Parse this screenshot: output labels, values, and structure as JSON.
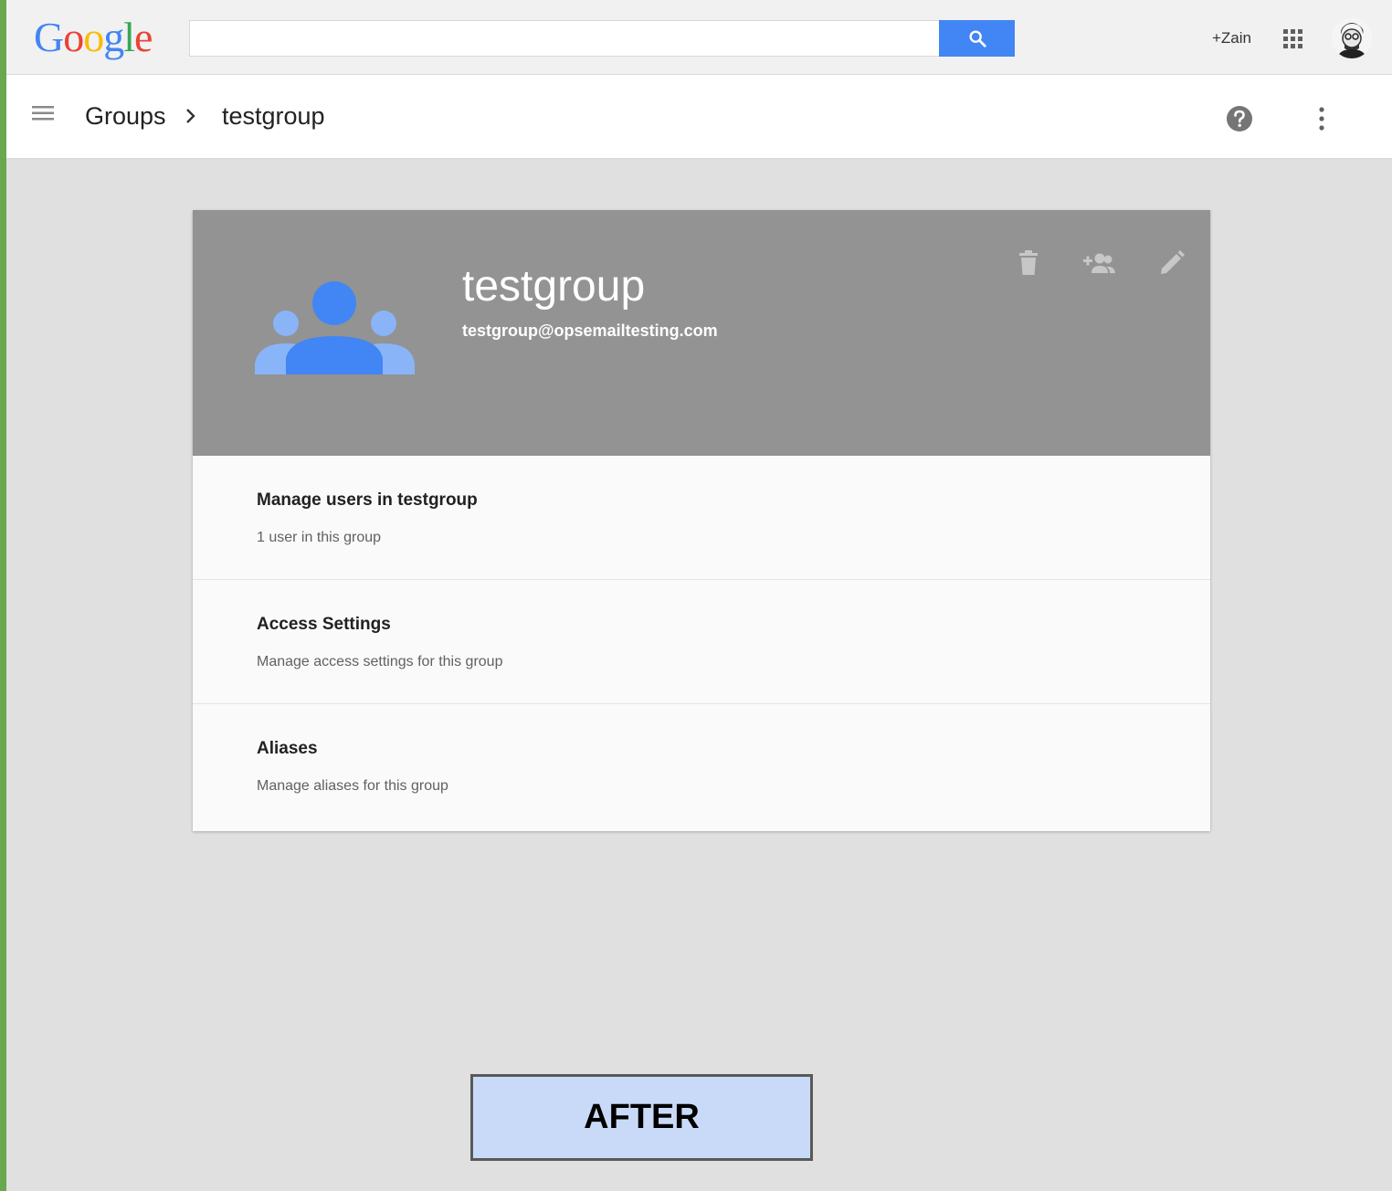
{
  "topbar": {
    "logo_letters": [
      "G",
      "o",
      "o",
      "g",
      "l",
      "e"
    ],
    "logo_colors": [
      "#4285f4",
      "#ea4335",
      "#fbbc05",
      "#4285f4",
      "#34a853",
      "#ea4335"
    ],
    "search": {
      "value": "",
      "placeholder": ""
    },
    "search_button_icon": "search-icon",
    "user_link": "+Zain",
    "apps_icon": "apps-grid-icon",
    "avatar_icon": "user-avatar"
  },
  "subheader": {
    "menu_icon": "hamburger-menu-icon",
    "breadcrumb": [
      "Groups",
      "testgroup"
    ],
    "help_icon": "help-icon",
    "more_icon": "more-vert-icon"
  },
  "card": {
    "header_color": "#939393",
    "group_icon": "group-icon",
    "title": "testgroup",
    "email": "testgroup@opsemailtesting.com",
    "actions": [
      "delete-icon",
      "add-member-icon",
      "edit-icon"
    ],
    "rows": [
      {
        "title": "Manage users in testgroup",
        "subtitle": "1 user in this group"
      },
      {
        "title": "Access Settings",
        "subtitle": "Manage access settings for this group"
      },
      {
        "title": "Aliases",
        "subtitle": "Manage aliases for this group"
      }
    ]
  },
  "label": "AFTER",
  "colors": {
    "accent": "#4285f4",
    "page_bg": "#e0e0e0",
    "label_bg": "#c9daf8",
    "edge": "#6aa84f"
  }
}
